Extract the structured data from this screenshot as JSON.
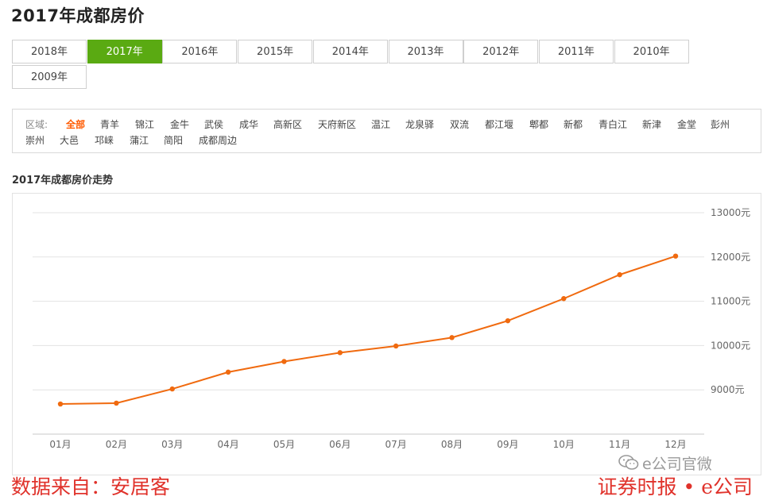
{
  "page": {
    "title": "2017年成都房价"
  },
  "year_tabs": [
    {
      "label": "2018年",
      "active": false
    },
    {
      "label": "2017年",
      "active": true
    },
    {
      "label": "2016年",
      "active": false
    },
    {
      "label": "2015年",
      "active": false
    },
    {
      "label": "2014年",
      "active": false
    },
    {
      "label": "2013年",
      "active": false
    },
    {
      "label": "2012年",
      "active": false
    },
    {
      "label": "2011年",
      "active": false
    },
    {
      "label": "2010年",
      "active": false
    },
    {
      "label": "2009年",
      "active": false
    }
  ],
  "regions": {
    "label": "区域:",
    "items": [
      {
        "label": "全部",
        "active": true
      },
      {
        "label": "青羊"
      },
      {
        "label": "锦江"
      },
      {
        "label": "金牛"
      },
      {
        "label": "武侯"
      },
      {
        "label": "成华"
      },
      {
        "label": "高新区"
      },
      {
        "label": "天府新区"
      },
      {
        "label": "温江"
      },
      {
        "label": "龙泉驿"
      },
      {
        "label": "双流"
      },
      {
        "label": "都江堰"
      },
      {
        "label": "郫都"
      },
      {
        "label": "新都"
      },
      {
        "label": "青白江"
      },
      {
        "label": "新津"
      },
      {
        "label": "金堂"
      },
      {
        "label": "彭州"
      },
      {
        "label": "崇州"
      },
      {
        "label": "大邑"
      },
      {
        "label": "邛崃"
      },
      {
        "label": "蒲江"
      },
      {
        "label": "简阳"
      },
      {
        "label": "成都周边"
      }
    ]
  },
  "chart_title": "2017年成都房价走势",
  "chart_data": {
    "type": "line",
    "title": "2017年成都房价走势",
    "categories": [
      "01月",
      "02月",
      "03月",
      "04月",
      "05月",
      "06月",
      "07月",
      "08月",
      "09月",
      "10月",
      "11月",
      "12月"
    ],
    "series": [
      {
        "values": [
          8680,
          8700,
          9020,
          9400,
          9640,
          9840,
          9990,
          10180,
          10560,
          11060,
          11600,
          12020
        ]
      }
    ],
    "y_ticks": [
      9000,
      10000,
      11000,
      12000,
      13000
    ],
    "y_unit": "元",
    "ylim": [
      8000,
      13000
    ],
    "y_axis_side": "right",
    "grid": true,
    "color": "#f06a0f"
  },
  "watermarks": {
    "left": "数据来自：安居客",
    "right": "证券时报 • e公司",
    "wechat": "e公司官微"
  }
}
